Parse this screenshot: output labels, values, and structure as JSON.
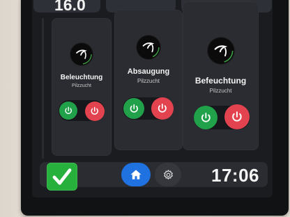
{
  "top": {
    "value": "16.0"
  },
  "cards": [
    {
      "title": "Beleuchtung",
      "subtitle": "Pilzzucht"
    },
    {
      "title": "Absaugung",
      "subtitle": "Pilzzucht"
    },
    {
      "title": "Befeuchtung",
      "subtitle": "Pilzzucht"
    }
  ],
  "bottom_bar": {
    "clock": "17:06",
    "status_icon": "checkmark-icon",
    "nav": [
      "home-icon",
      "gear-icon"
    ]
  },
  "colors": {
    "on": "#21a24a",
    "off": "#e2434f",
    "accent": "#1f72e0",
    "ok": "#27b13c"
  }
}
